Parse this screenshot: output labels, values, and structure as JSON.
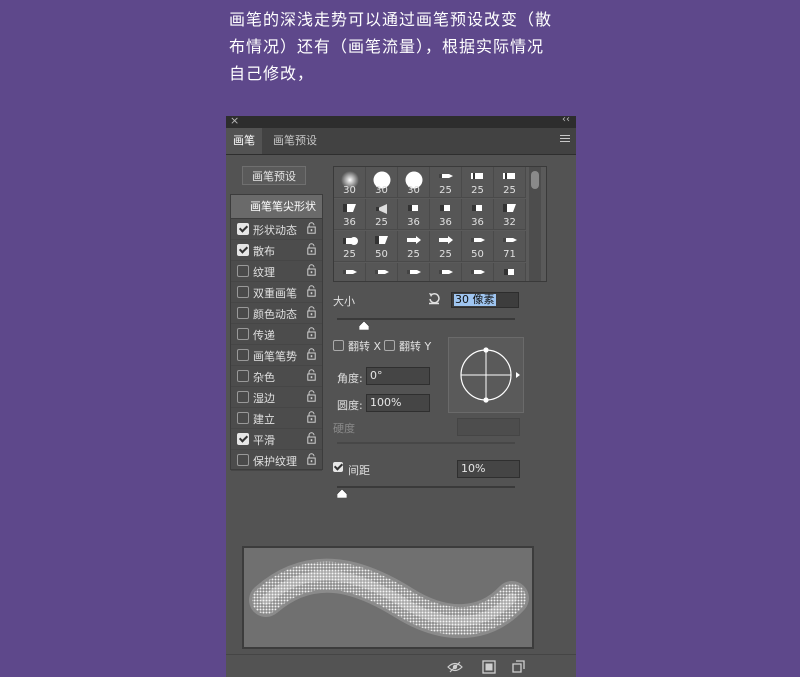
{
  "caption": {
    "lines": [
      "画笔的深浅走势可以通过画笔预设改变（散",
      "布情况）还有（画笔流量），根据实际情况",
      "自己修改，"
    ]
  },
  "panel": {
    "close_glyph": "×",
    "collapse_glyph": "‹‹",
    "tabs": [
      {
        "label": "画笔",
        "active": true
      },
      {
        "label": "画笔预设",
        "active": false
      }
    ],
    "preset_button": "画笔预设",
    "options_header": "画笔笔尖形状",
    "options": [
      {
        "label": "形状动态",
        "checked": true
      },
      {
        "label": "散布",
        "checked": true
      },
      {
        "label": "纹理",
        "checked": false
      },
      {
        "label": "双重画笔",
        "checked": false
      },
      {
        "label": "颜色动态",
        "checked": false
      },
      {
        "label": "传递",
        "checked": false
      },
      {
        "label": "画笔笔势",
        "checked": false
      },
      {
        "label": "杂色",
        "checked": false
      },
      {
        "label": "湿边",
        "checked": false
      },
      {
        "label": "建立",
        "checked": false
      },
      {
        "label": "平滑",
        "checked": true
      },
      {
        "label": "保护纹理",
        "checked": false
      }
    ],
    "brush_tips": [
      {
        "size": "30",
        "shape": "soft-round"
      },
      {
        "size": "30",
        "shape": "hard-round"
      },
      {
        "size": "30",
        "shape": "hard-round"
      },
      {
        "size": "25",
        "shape": "pencil"
      },
      {
        "size": "25",
        "shape": "marker"
      },
      {
        "size": "25",
        "shape": "marker"
      },
      {
        "size": "36",
        "shape": "wedge"
      },
      {
        "size": "25",
        "shape": "fan"
      },
      {
        "size": "36",
        "shape": "flat"
      },
      {
        "size": "36",
        "shape": "flat"
      },
      {
        "size": "36",
        "shape": "flat"
      },
      {
        "size": "32",
        "shape": "wedge"
      },
      {
        "size": "25",
        "shape": "round-tip"
      },
      {
        "size": "50",
        "shape": "wedge"
      },
      {
        "size": "25",
        "shape": "arrow"
      },
      {
        "size": "25",
        "shape": "arrow"
      },
      {
        "size": "50",
        "shape": "pencil"
      },
      {
        "size": "71",
        "shape": "pencil"
      },
      {
        "size": "",
        "shape": "pencil"
      },
      {
        "size": "",
        "shape": "pencil"
      },
      {
        "size": "",
        "shape": "pencil"
      },
      {
        "size": "",
        "shape": "pencil"
      },
      {
        "size": "",
        "shape": "pencil"
      },
      {
        "size": "",
        "shape": "flat"
      }
    ],
    "size_label": "大小",
    "size_value": "30 像素",
    "size_slider": 0.15,
    "flip_x": "翻转 X",
    "flip_y": "翻转 Y",
    "angle_label": "角度:",
    "angle_value": "0°",
    "roundness_label": "圆度:",
    "roundness_value": "100%",
    "hardness_label": "硬度",
    "spacing_label": "间距",
    "spacing_checked": true,
    "spacing_value": "10%",
    "spacing_slider": 0.03,
    "colors": {
      "background": "#5e488b",
      "panel": "#535353",
      "preview": "#707070"
    }
  }
}
